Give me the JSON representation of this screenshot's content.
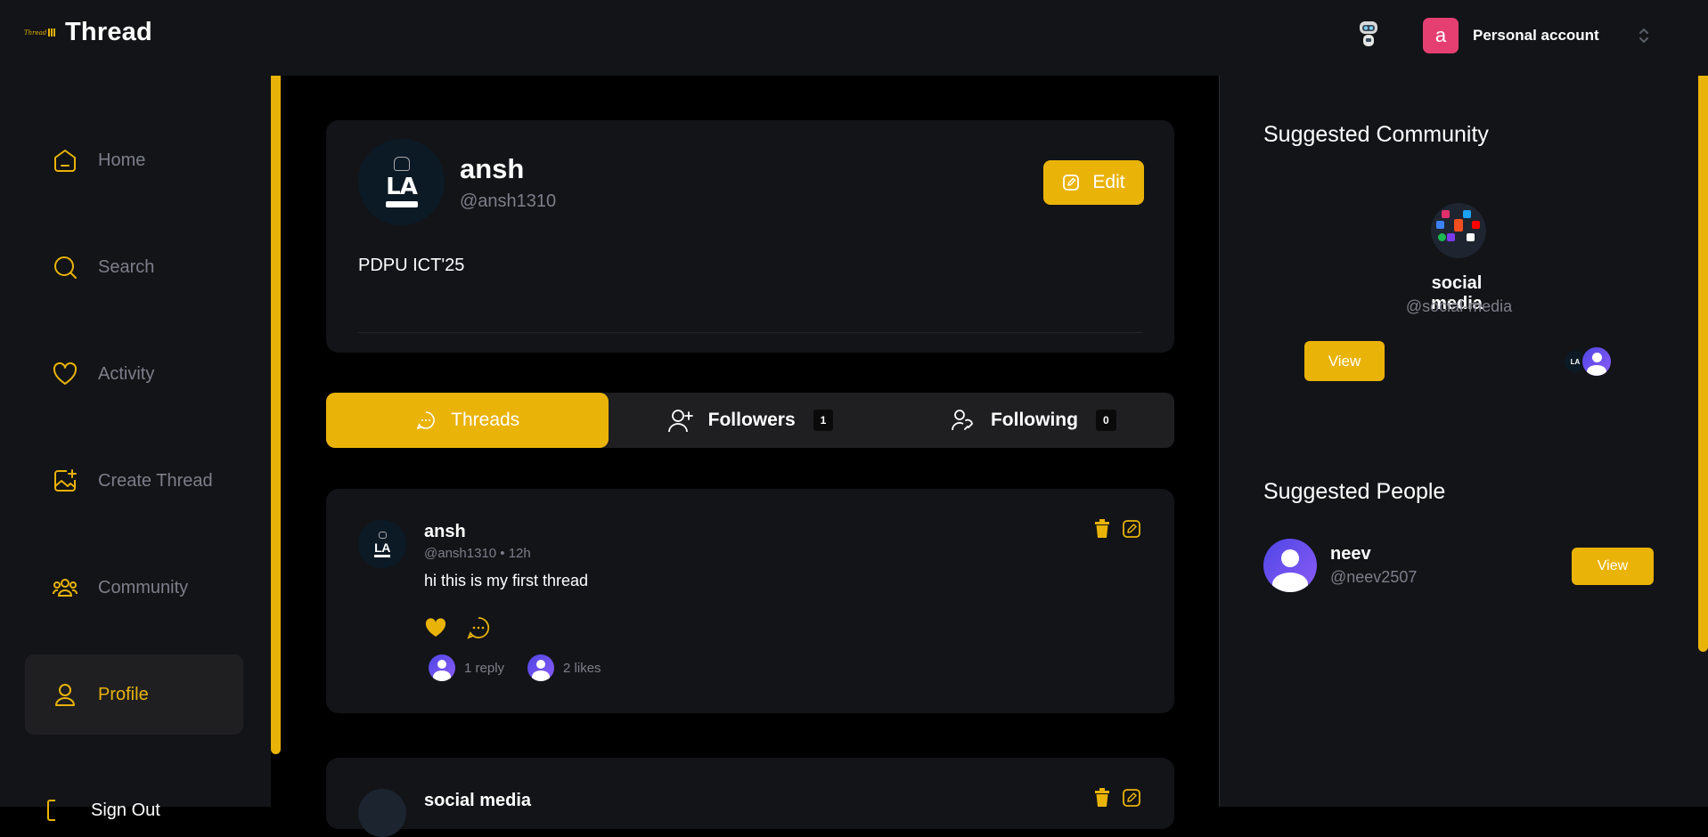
{
  "app": {
    "name": "Thread"
  },
  "account": {
    "initial": "a",
    "label": "Personal account"
  },
  "sidebar": {
    "items": [
      {
        "label": "Home",
        "icon": "home-icon"
      },
      {
        "label": "Search",
        "icon": "search-icon"
      },
      {
        "label": "Activity",
        "icon": "heart-icon"
      },
      {
        "label": "Create Thread",
        "icon": "create-image-icon"
      },
      {
        "label": "Community",
        "icon": "community-icon"
      },
      {
        "label": "Profile",
        "icon": "user-icon",
        "active": true
      }
    ],
    "signout_label": "Sign Out"
  },
  "profile": {
    "initials": "LA",
    "name": "ansh",
    "handle": "@ansh1310",
    "edit_label": "Edit",
    "bio": "PDPU ICT'25"
  },
  "tabs": [
    {
      "label": "Threads",
      "active": true
    },
    {
      "label": "Followers",
      "count": "1"
    },
    {
      "label": "Following",
      "count": "0"
    }
  ],
  "threads": [
    {
      "author": "ansh",
      "meta": "@ansh1310 • 12h",
      "text": "hi this is my first thread",
      "replies": "1 reply",
      "likes": "2 likes",
      "liked": true
    },
    {
      "author": "social media"
    }
  ],
  "suggested_community": {
    "title": "Suggested Community",
    "name": "social media",
    "handle": "@social-media",
    "view_label": "View"
  },
  "suggested_people": {
    "title": "Suggested People",
    "name": "neev",
    "handle": "@neev2507",
    "view_label": "View"
  },
  "colors": {
    "accent": "#eab308",
    "panel": "#121417",
    "muted": "#7c7f8a",
    "account": "#e53f72"
  }
}
